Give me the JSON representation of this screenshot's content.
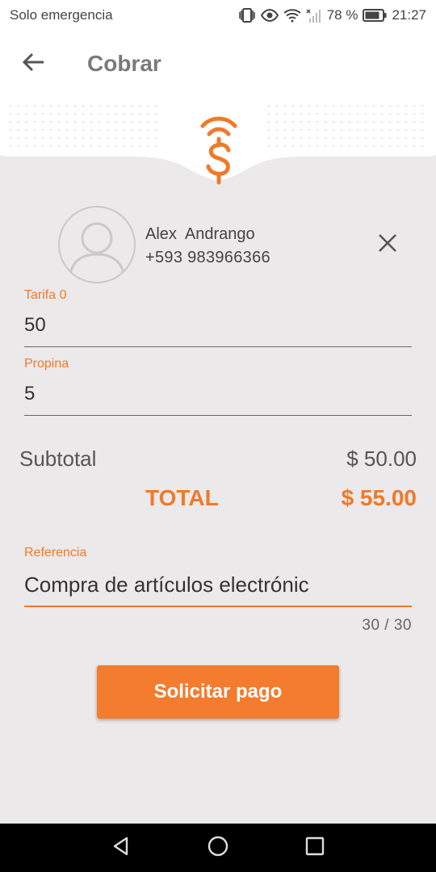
{
  "status_bar": {
    "carrier": "Solo emergencia",
    "battery": "78 %",
    "time": "21:27",
    "icons": [
      "vibrate-icon",
      "eye-icon",
      "wifi-icon",
      "signal-icon",
      "battery-icon"
    ]
  },
  "app_bar": {
    "title": "Cobrar",
    "back_icon": "arrow-left-icon"
  },
  "banner": {
    "logo_icon": "wireless-dollar-icon",
    "accent_color": "#f07a28"
  },
  "contact": {
    "name": "Alex  Andrango",
    "phone": "+593 983966366",
    "avatar_icon": "user-avatar-icon",
    "clear_icon": "close-icon"
  },
  "form": {
    "tarifa": {
      "label": "Tarifa 0",
      "value": "50"
    },
    "propina": {
      "label": "Propina",
      "value": "5"
    },
    "referencia": {
      "label": "Referencia",
      "value": "Compra de artículos electrónic",
      "counter": "30 / 30"
    }
  },
  "totals": {
    "subtotal_label": "Subtotal",
    "subtotal_value": "$ 50.00",
    "total_label": "TOTAL",
    "total_value": "$ 55.00"
  },
  "actions": {
    "request_payment": "Solicitar pago"
  },
  "nav_bar": {
    "icons": [
      "back-triangle-icon",
      "home-circle-icon",
      "recents-square-icon"
    ]
  }
}
